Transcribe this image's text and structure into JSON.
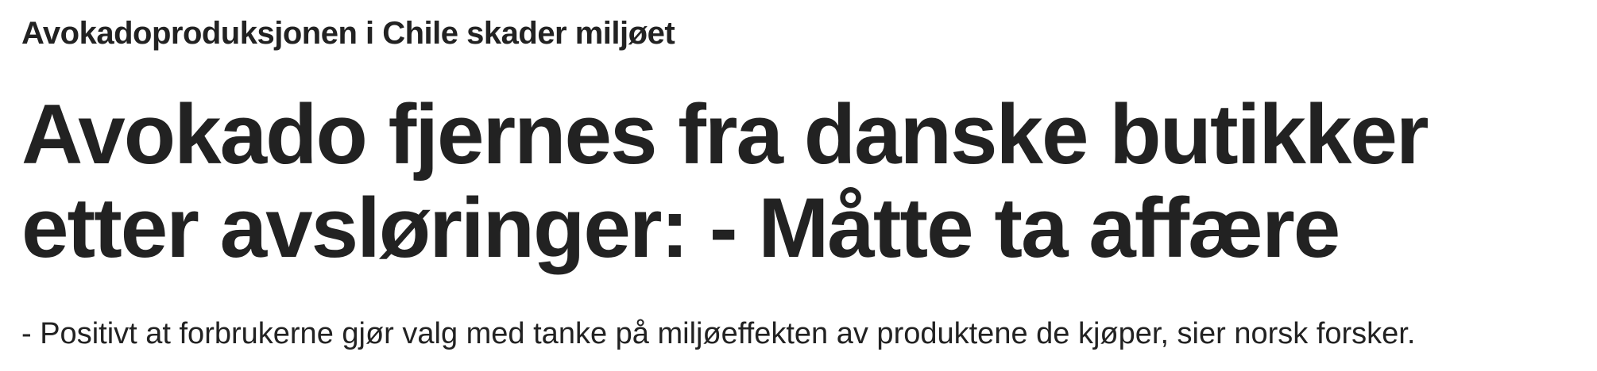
{
  "article": {
    "kicker": "Avokadoproduksjonen i Chile skader miljøet",
    "headline": "Avokado fjernes fra danske butikker etter avsløringer: - Måtte ta affære",
    "lead": "- Positivt at forbrukerne gjør valg med tanke på miljøeffekten av produktene de kjøper, sier norsk forsker."
  },
  "colors": {
    "text": "#222222",
    "background": "#ffffff"
  }
}
